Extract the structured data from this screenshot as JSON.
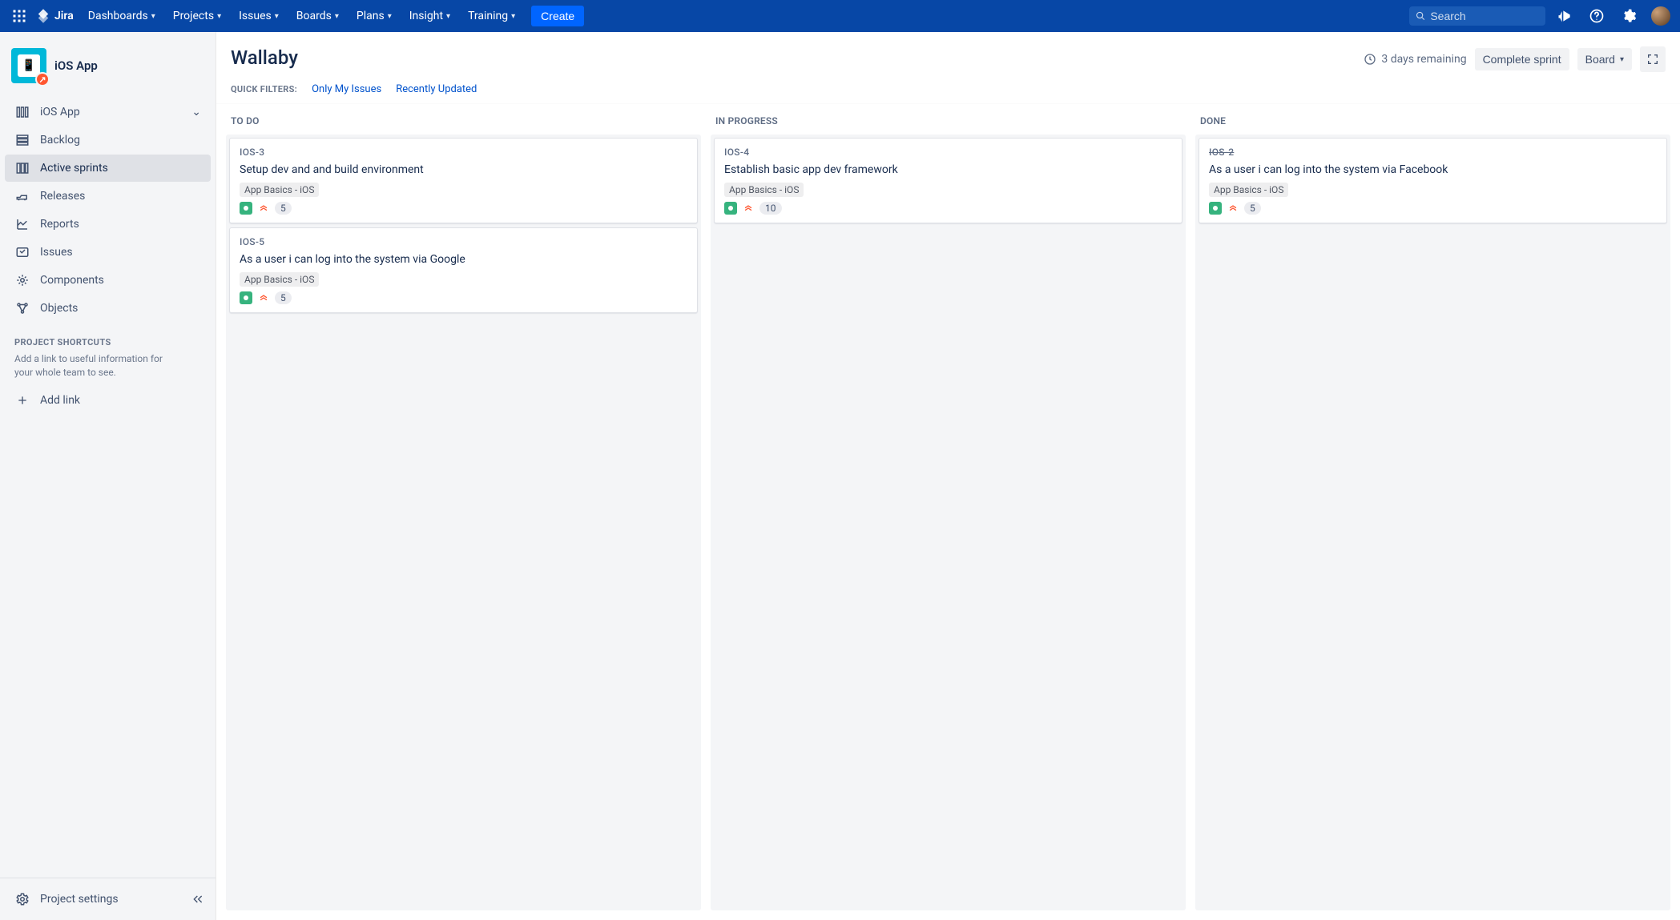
{
  "topnav": {
    "product": "Jira",
    "items": [
      {
        "label": "Dashboards"
      },
      {
        "label": "Projects"
      },
      {
        "label": "Issues"
      },
      {
        "label": "Boards"
      },
      {
        "label": "Plans"
      },
      {
        "label": "Insight"
      },
      {
        "label": "Training"
      }
    ],
    "create_label": "Create",
    "search_placeholder": "Search"
  },
  "sidebar": {
    "project_name": "iOS App",
    "expandable": {
      "label": "iOS App"
    },
    "items": [
      {
        "icon": "backlog-icon",
        "label": "Backlog"
      },
      {
        "icon": "sprint-icon",
        "label": "Active sprints",
        "active": true
      },
      {
        "icon": "releases-icon",
        "label": "Releases"
      },
      {
        "icon": "reports-icon",
        "label": "Reports"
      },
      {
        "icon": "issues-icon",
        "label": "Issues"
      },
      {
        "icon": "components-icon",
        "label": "Components"
      },
      {
        "icon": "objects-icon",
        "label": "Objects"
      }
    ],
    "shortcuts_heading": "PROJECT SHORTCUTS",
    "shortcuts_desc": "Add a link to useful information for your whole team to see.",
    "add_link_label": "Add link",
    "footer_label": "Project settings"
  },
  "board": {
    "title": "Wallaby",
    "remaining": "3 days remaining",
    "complete_label": "Complete sprint",
    "board_menu_label": "Board",
    "filters_label": "QUICK FILTERS:",
    "filters": [
      {
        "label": "Only My Issues"
      },
      {
        "label": "Recently Updated"
      }
    ],
    "columns": [
      {
        "name": "TO DO",
        "cards": [
          {
            "key": "IOS-3",
            "summary": "Setup dev and and build environment",
            "epic": "App Basics - iOS",
            "type": "story",
            "priority": "high",
            "estimate": "5",
            "done": false
          },
          {
            "key": "IOS-5",
            "summary": "As a user i can log into the system via Google",
            "epic": "App Basics - iOS",
            "type": "story",
            "priority": "high",
            "estimate": "5",
            "done": false
          }
        ]
      },
      {
        "name": "IN PROGRESS",
        "cards": [
          {
            "key": "IOS-4",
            "summary": "Establish basic app dev framework",
            "epic": "App Basics - iOS",
            "type": "story",
            "priority": "high",
            "estimate": "10",
            "done": false
          }
        ]
      },
      {
        "name": "DONE",
        "cards": [
          {
            "key": "IOS-2",
            "summary": "As a user i can log into the system via Facebook",
            "epic": "App Basics - iOS",
            "type": "story",
            "priority": "high",
            "estimate": "5",
            "done": true
          }
        ]
      }
    ]
  }
}
